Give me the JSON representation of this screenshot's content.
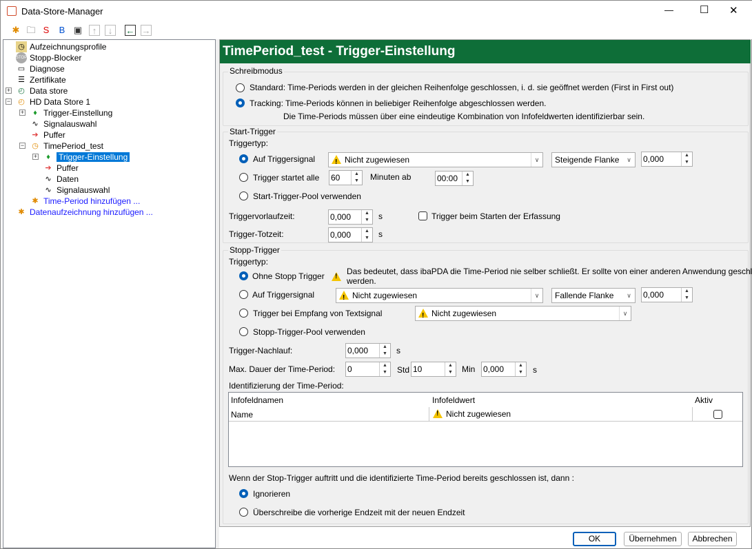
{
  "window": {
    "title": "Data-Store-Manager",
    "minimize": "—",
    "maximize": "☐",
    "close": "✕"
  },
  "toolbar": {
    "buttons": [
      "new-profile",
      "open",
      "open-s",
      "open-b",
      "save",
      "move-up",
      "move-down",
      "back",
      "forward"
    ]
  },
  "tree": {
    "items": [
      {
        "label": "Aufzeichnungsprofile",
        "icon": "profile-icon"
      },
      {
        "label": "Stopp-Blocker",
        "icon": "stop-icon"
      },
      {
        "label": "Diagnose",
        "icon": "monitor-icon"
      },
      {
        "label": "Zertifikate",
        "icon": "certificate-icon"
      },
      {
        "label": "Data store",
        "icon": "datastore-icon"
      },
      {
        "label": "HD Data Store 1",
        "icon": "hd-datastore-icon"
      },
      {
        "label": "Trigger-Einstellung",
        "icon": "trigger-icon"
      },
      {
        "label": "Signalauswahl",
        "icon": "signal-icon"
      },
      {
        "label": "Puffer",
        "icon": "buffer-icon"
      },
      {
        "label": "TimePeriod_test",
        "icon": "timeperiod-icon"
      },
      {
        "label": "Trigger-Einstellung",
        "icon": "trigger-icon",
        "selected": true
      },
      {
        "label": "Puffer",
        "icon": "buffer-icon"
      },
      {
        "label": "Daten",
        "icon": "signal-icon"
      },
      {
        "label": "Signalauswahl",
        "icon": "signal-icon"
      },
      {
        "label": "Time-Period hinzufügen ...",
        "icon": "add-icon"
      },
      {
        "label": "Datenaufzeichnung hinzufügen ...",
        "icon": "add-icon"
      }
    ]
  },
  "header": {
    "title": "TimePeriod_test - Trigger-Einstellung",
    "color": "#0e6e38"
  },
  "schreibmodus": {
    "title": "Schreibmodus",
    "standard": "Standard: Time-Periods werden in der gleichen Reihenfolge geschlossen, i. d. sie geöffnet werden (First in First out)",
    "tracking": "Tracking: Time-Periods können in beliebiger Reihenfolge abgeschlossen werden.",
    "tracking_note": "Die Time-Periods müssen über eine eindeutige Kombination von Infofeldwerten identifizierbar sein.",
    "selected": "tracking"
  },
  "start": {
    "title": "Start-Trigger",
    "triggertyp": "Triggertyp:",
    "auf_signal": "Auf Triggersignal",
    "signal_value": "Nicht zugewiesen",
    "flanke": "Steigende Flanke",
    "level": "0,000",
    "startet_alle": "Trigger startet alle",
    "minutes": "60",
    "minuten_ab": "Minuten ab",
    "time": "00:00",
    "pool": "Start-Trigger-Pool verwenden",
    "vorlauf_label": "Triggervorlaufzeit:",
    "vorlauf": "0,000",
    "unit_s": "s",
    "beim_start": "Trigger beim Starten der Erfassung",
    "totzeit_label": "Trigger-Totzeit:",
    "totzeit": "0,000",
    "selected": "auf_signal"
  },
  "stop": {
    "title": "Stopp-Trigger",
    "triggertyp": "Triggertyp:",
    "ohne": "Ohne Stopp Trigger",
    "ohne_note1": "Das bedeutet, dass ibaPDA die Time-Period nie selber schließt. Er sollte von einer anderen Anwendung geschlossen",
    "ohne_note2": "werden.",
    "auf_signal": "Auf Triggersignal",
    "signal_value": "Nicht zugewiesen",
    "flanke": "Fallende Flanke",
    "level": "0,000",
    "textsignal": "Trigger bei Empfang von Textsignal",
    "text_value": "Nicht zugewiesen",
    "pool": "Stopp-Trigger-Pool verwenden",
    "nachlauf_label": "Trigger-Nachlauf:",
    "nachlauf": "0,000",
    "unit_s": "s",
    "maxdauer_label": "Max. Dauer der Time-Period:",
    "hours": "0",
    "std": "Std",
    "minutes": "10",
    "min": "Min",
    "seconds": "0,000",
    "selected": "ohne"
  },
  "ident": {
    "title": "Identifizierung der Time-Period:",
    "columns": [
      "Infofeldnamen",
      "Infofeldwert",
      "Aktiv"
    ],
    "rows": [
      {
        "name": "Name",
        "value": "Nicht zugewiesen",
        "active": false
      }
    ]
  },
  "closed": {
    "question": "Wenn der Stop-Trigger auftritt und die identifizierte Time-Period bereits geschlossen ist, dann :",
    "ignore": "Ignorieren",
    "overwrite": "Überschreibe die vorherige Endzeit mit der neuen Endzeit",
    "selected": "ignore"
  },
  "buttons": {
    "ok": "OK",
    "apply": "Übernehmen",
    "cancel": "Abbrechen"
  }
}
